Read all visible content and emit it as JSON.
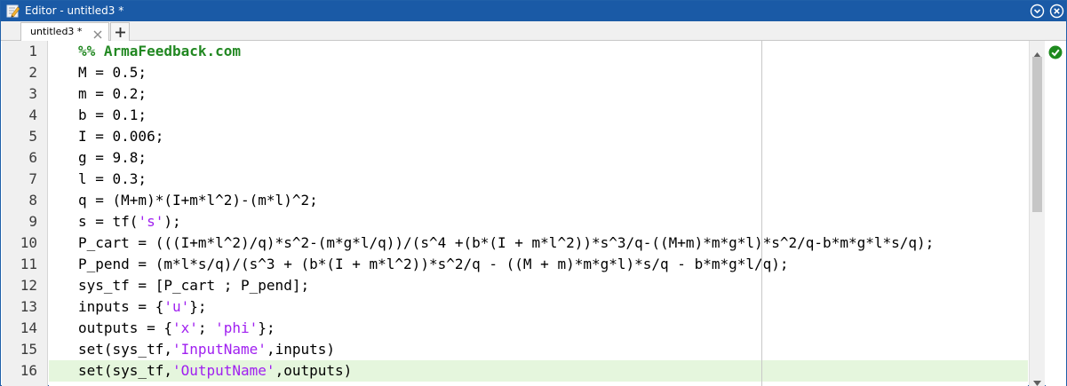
{
  "window": {
    "title": "Editor - untitled3 *"
  },
  "tabs": [
    {
      "label": "untitled3 *",
      "active": true
    }
  ],
  "icons": {
    "app": "editor-pencil-icon",
    "menu": "chevron-circle-down-icon",
    "close": "close-circle-icon",
    "tab_close": "close-x-icon",
    "add_tab": "plus-icon",
    "status": "check-circle-icon"
  },
  "colors": {
    "titlebar": "#1a5aa6",
    "cell_title": "#228822",
    "string": "#a020f0",
    "current_line": "#e5f6dd",
    "status_ok": "#1e8a1e"
  },
  "editor": {
    "current_line": 16,
    "lines": [
      {
        "n": "1",
        "parts": [
          {
            "t": "%% ArmaFeedback.com",
            "k": "cell"
          }
        ]
      },
      {
        "n": "2",
        "parts": [
          {
            "t": "M = 0.5;",
            "k": "code"
          }
        ]
      },
      {
        "n": "3",
        "parts": [
          {
            "t": "m = 0.2;",
            "k": "code"
          }
        ]
      },
      {
        "n": "4",
        "parts": [
          {
            "t": "b = 0.1;",
            "k": "code"
          }
        ]
      },
      {
        "n": "5",
        "parts": [
          {
            "t": "I = 0.006;",
            "k": "code"
          }
        ]
      },
      {
        "n": "6",
        "parts": [
          {
            "t": "g = 9.8;",
            "k": "code"
          }
        ]
      },
      {
        "n": "7",
        "parts": [
          {
            "t": "l = 0.3;",
            "k": "code"
          }
        ]
      },
      {
        "n": "8",
        "parts": [
          {
            "t": "q = (M+m)*(I+m*l^2)-(m*l)^2;",
            "k": "code"
          }
        ]
      },
      {
        "n": "9",
        "parts": [
          {
            "t": "s = tf(",
            "k": "code"
          },
          {
            "t": "'s'",
            "k": "str"
          },
          {
            "t": ");",
            "k": "code"
          }
        ]
      },
      {
        "n": "10",
        "parts": [
          {
            "t": "P_cart = (((I+m*l^2)/q)*s^2-(m*g*l/q))/(s^4 +(b*(I + m*l^2))*s^3/q-((M+m)*m*g*l)*s^2/q-b*m*g*l*s/q);",
            "k": "code"
          }
        ]
      },
      {
        "n": "11",
        "parts": [
          {
            "t": "P_pend = (m*l*s/q)/(s^3 + (b*(I + m*l^2))*s^2/q - ((M + m)*m*g*l)*s/q - b*m*g*l/q);",
            "k": "code"
          }
        ]
      },
      {
        "n": "12",
        "parts": [
          {
            "t": "sys_tf = [P_cart ; P_pend];",
            "k": "code"
          }
        ]
      },
      {
        "n": "13",
        "parts": [
          {
            "t": "inputs = {",
            "k": "code"
          },
          {
            "t": "'u'",
            "k": "str"
          },
          {
            "t": "};",
            "k": "code"
          }
        ]
      },
      {
        "n": "14",
        "parts": [
          {
            "t": "outputs = {",
            "k": "code"
          },
          {
            "t": "'x'",
            "k": "str"
          },
          {
            "t": "; ",
            "k": "code"
          },
          {
            "t": "'phi'",
            "k": "str"
          },
          {
            "t": "};",
            "k": "code"
          }
        ]
      },
      {
        "n": "15",
        "parts": [
          {
            "t": "set(sys_tf,",
            "k": "code"
          },
          {
            "t": "'InputName'",
            "k": "str"
          },
          {
            "t": ",inputs)",
            "k": "code"
          }
        ]
      },
      {
        "n": "16",
        "parts": [
          {
            "t": "set(sys_tf,",
            "k": "code"
          },
          {
            "t": "'OutputName'",
            "k": "str"
          },
          {
            "t": ",outputs)",
            "k": "code"
          }
        ]
      }
    ]
  }
}
